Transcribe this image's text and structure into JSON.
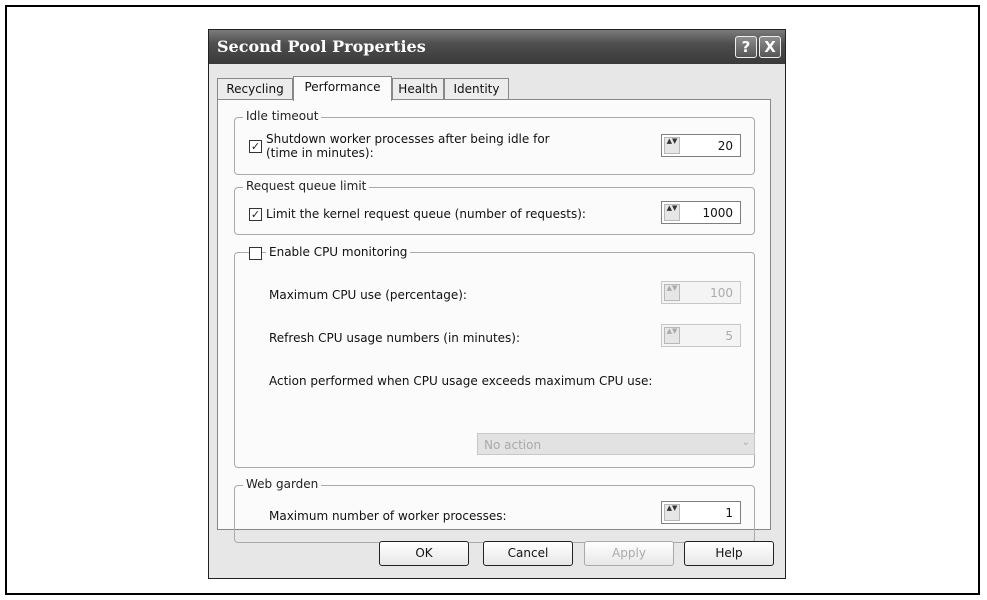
{
  "window": {
    "title": "Second Pool Properties",
    "help_glyph": "?",
    "close_glyph": "X"
  },
  "tabs": [
    {
      "label": "Recycling",
      "active": false
    },
    {
      "label": "Performance",
      "active": true
    },
    {
      "label": "Health",
      "active": false
    },
    {
      "label": "Identity",
      "active": false
    }
  ],
  "idle_timeout": {
    "legend": "Idle timeout",
    "checkbox_label_line1": "Shutdown worker processes after being idle for",
    "checkbox_label_line2": "(time in minutes):",
    "checked": true,
    "value": "20"
  },
  "request_queue": {
    "legend": "Request queue limit",
    "checkbox_label": "Limit the kernel request queue (number of requests):",
    "checked": true,
    "value": "1000"
  },
  "cpu_monitoring": {
    "checkbox_label": "Enable CPU monitoring",
    "checked": false,
    "max_cpu_label": "Maximum CPU use (percentage):",
    "max_cpu_value": "100",
    "refresh_label": "Refresh CPU usage numbers (in minutes):",
    "refresh_value": "5",
    "action_label": "Action performed when CPU usage exceeds maximum CPU use:",
    "action_value": "No action"
  },
  "web_garden": {
    "legend": "Web garden",
    "max_workers_label": "Maximum number of worker processes:",
    "value": "1"
  },
  "buttons": {
    "ok": "OK",
    "cancel": "Cancel",
    "apply": "Apply",
    "help": "Help"
  },
  "glyphs": {
    "check": "✓",
    "spin": "▲▼",
    "chevron": "⌄"
  }
}
